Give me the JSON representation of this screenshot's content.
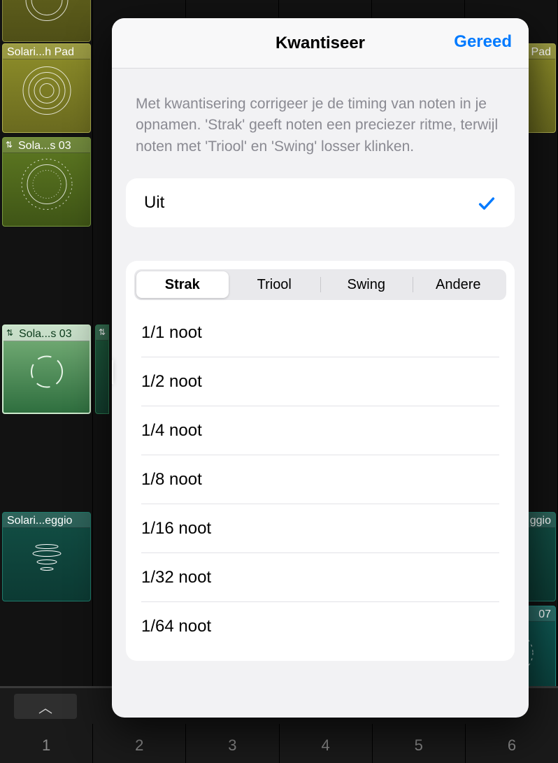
{
  "background": {
    "cells": [
      {
        "label": "Solari...h Pad"
      },
      {
        "label": "Sola...s 03"
      },
      {
        "label": "Sola...s 03"
      },
      {
        "label": "Solari...eggio"
      },
      {
        "label": "Pad"
      },
      {
        "label": "ggio"
      },
      {
        "label": "07"
      }
    ]
  },
  "toolbar": {
    "markers": [
      "1",
      "2",
      "3",
      "4",
      "5",
      "6"
    ]
  },
  "popover": {
    "title": "Kwantiseer",
    "done": "Gereed",
    "description": "Met kwantisering corrigeer je de timing van noten in je opnamen. 'Strak' geeft noten een preciezer ritme, terwijl noten met 'Triool' en 'Swing' losser klinken.",
    "off_label": "Uit",
    "segments": [
      "Strak",
      "Triool",
      "Swing",
      "Andere"
    ],
    "active_segment": 0,
    "options": [
      "1/1 noot",
      "1/2 noot",
      "1/4 noot",
      "1/8 noot",
      "1/16 noot",
      "1/32 noot",
      "1/64 noot"
    ]
  }
}
